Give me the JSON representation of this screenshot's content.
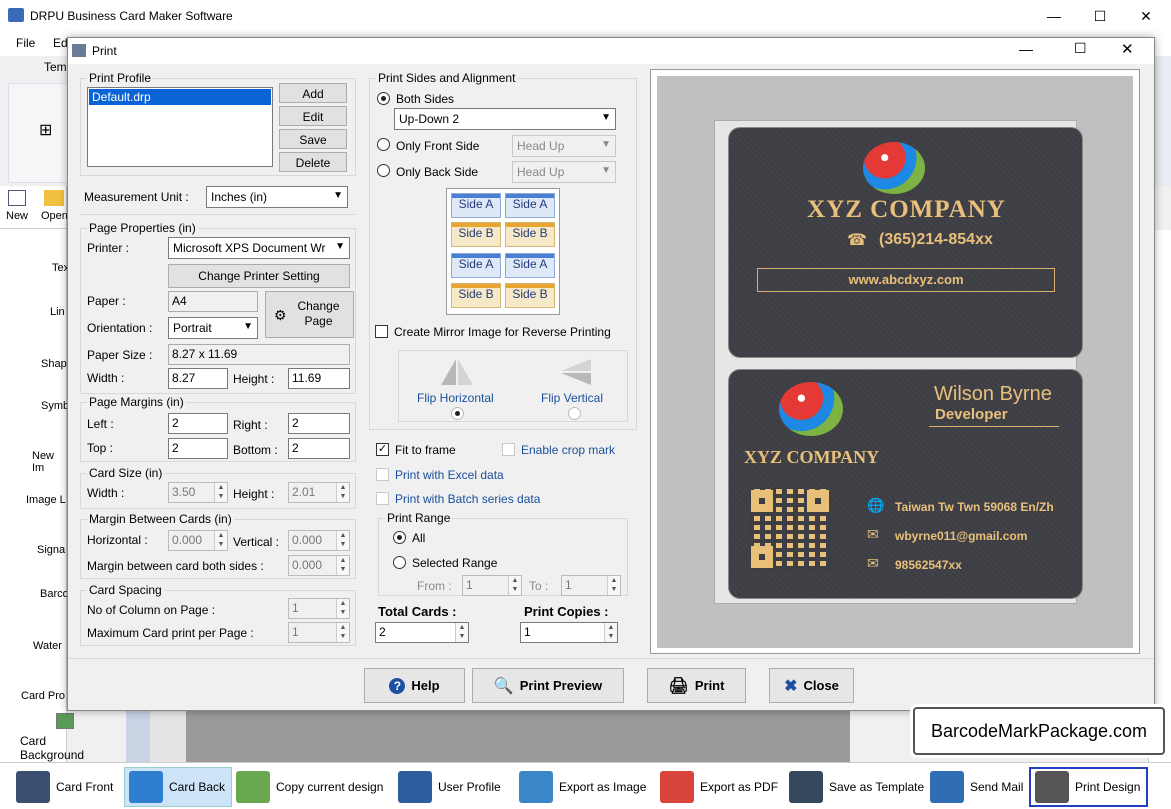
{
  "app": {
    "title": "DRPU Business Card Maker Software",
    "menu": [
      "File",
      "Ed",
      "Tem"
    ]
  },
  "left_panel": {
    "quick": [
      "New",
      "Open"
    ],
    "items": [
      "Tex",
      "Lin",
      "Shap",
      "Symb",
      "New Im",
      "Image L",
      "Signa",
      "Barco",
      "Water",
      "Card Pro",
      "Card Background"
    ]
  },
  "dialog": {
    "title": "Print",
    "print_profile": {
      "label": "Print Profile",
      "items": [
        "Default.drp"
      ],
      "buttons": [
        "Add",
        "Edit",
        "Save",
        "Delete"
      ]
    },
    "measurement": {
      "label": "Measurement Unit :",
      "value": "Inches (in)"
    },
    "page_properties": {
      "label": "Page Properties (in)",
      "printer_label": "Printer :",
      "printer": "Microsoft XPS Document Wr",
      "change_printer": "Change Printer Setting",
      "paper_label": "Paper :",
      "paper": "A4",
      "change_page": "Change Page",
      "orientation_label": "Orientation :",
      "orientation": "Portrait",
      "paper_size_label": "Paper Size :",
      "paper_size": "8.27 x 11.69",
      "width_label": "Width :",
      "width": "8.27",
      "height_label": "Height :",
      "height": "11.69"
    },
    "page_margins": {
      "label": "Page Margins (in)",
      "left_label": "Left :",
      "left": "2",
      "right_label": "Right :",
      "right": "2",
      "top_label": "Top :",
      "top": "2",
      "bottom_label": "Bottom :",
      "bottom": "2"
    },
    "card_size": {
      "label": "Card Size (in)",
      "width_label": "Width :",
      "width": "3.50",
      "height_label": "Height :",
      "height": "2.01"
    },
    "margin_between": {
      "label": "Margin Between Cards (in)",
      "horizontal_label": "Horizontal :",
      "horizontal": "0.000",
      "vertical_label": "Vertical :",
      "vertical": "0.000",
      "both_label": "Margin between card both sides :",
      "both": "0.000"
    },
    "card_spacing": {
      "label": "Card Spacing",
      "columns_label": "No of Column on Page :",
      "columns": "1",
      "max_label": "Maximum Card print per Page :",
      "max": "1"
    },
    "sides": {
      "label": "Print Sides and Alignment",
      "both": "Both Sides",
      "both_value": "Up-Down 2",
      "front": "Only Front Side",
      "front_value": "Head Up",
      "back": "Only Back Side",
      "back_value": "Head Up",
      "side_a": "Side A",
      "side_b": "Side B",
      "mirror": "Create Mirror Image for Reverse Printing",
      "flip_h": "Flip Horizontal",
      "flip_v": "Flip Vertical"
    },
    "options": {
      "fit": "Fit to frame",
      "crop": "Enable crop mark",
      "excel": "Print with Excel data",
      "batch": "Print with Batch series data"
    },
    "range": {
      "label": "Print Range",
      "all": "All",
      "selected": "Selected Range",
      "from_label": "From :",
      "from": "1",
      "to_label": "To :",
      "to": "1"
    },
    "totals": {
      "total_label": "Total Cards :",
      "total": "2",
      "copies_label": "Print Copies :",
      "copies": "1"
    },
    "buttons": {
      "help": "Help",
      "preview": "Print Preview",
      "print": "Print",
      "close": "Close"
    }
  },
  "card_front": {
    "company": "XYZ COMPANY",
    "phone": "(365)214-854xx",
    "web": "www.abcdxyz.com"
  },
  "card_back": {
    "name": "Wilson Byrne",
    "role": "Developer",
    "company": "XYZ COMPANY",
    "address": "Taiwan Tw Twn 59068 En/Zh",
    "email": "wbyrne011@gmail.com",
    "phone": "98562547xx"
  },
  "watermark": "BarcodeMarkPackage.com",
  "toolbar": [
    "Card Front",
    "Card Back",
    "Copy current design",
    "User Profile",
    "Export as Image",
    "Export as PDF",
    "Save as Template",
    "Send Mail",
    "Print Design"
  ],
  "colors": {
    "accent": "#1a4f9c",
    "card_bg": "#3d3e44",
    "gold": "#e8c07a"
  }
}
